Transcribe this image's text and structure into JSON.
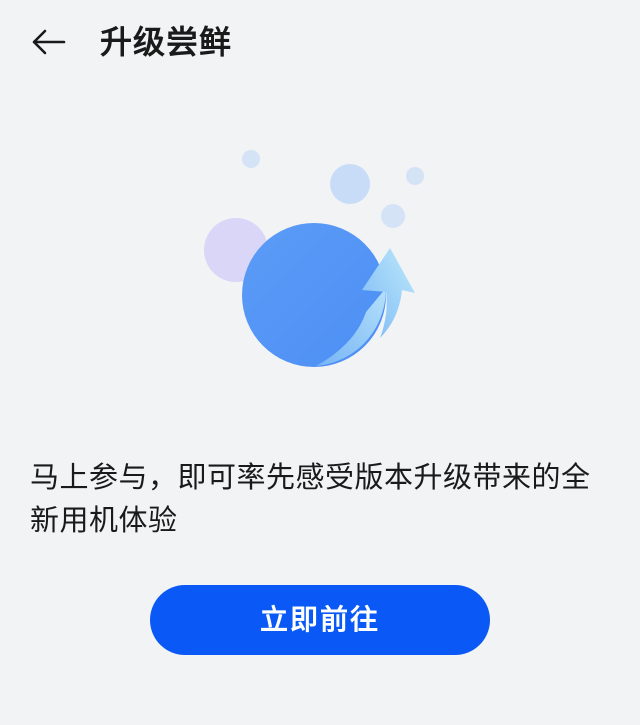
{
  "header": {
    "back_icon": "arrow-left-icon",
    "title": "升级尝鲜"
  },
  "illustration": {
    "icon": "upgrade-arrow-circle-icon"
  },
  "main": {
    "description": "马上参与，即可率先感受版本升级带来的全新用机体验"
  },
  "action": {
    "label": "立即前往"
  },
  "colors": {
    "background": "#f1f3f5",
    "accent": "#0a59f7",
    "bubble_blue": "#5b9cf6",
    "bubble_purple": "#d9d6f7"
  }
}
